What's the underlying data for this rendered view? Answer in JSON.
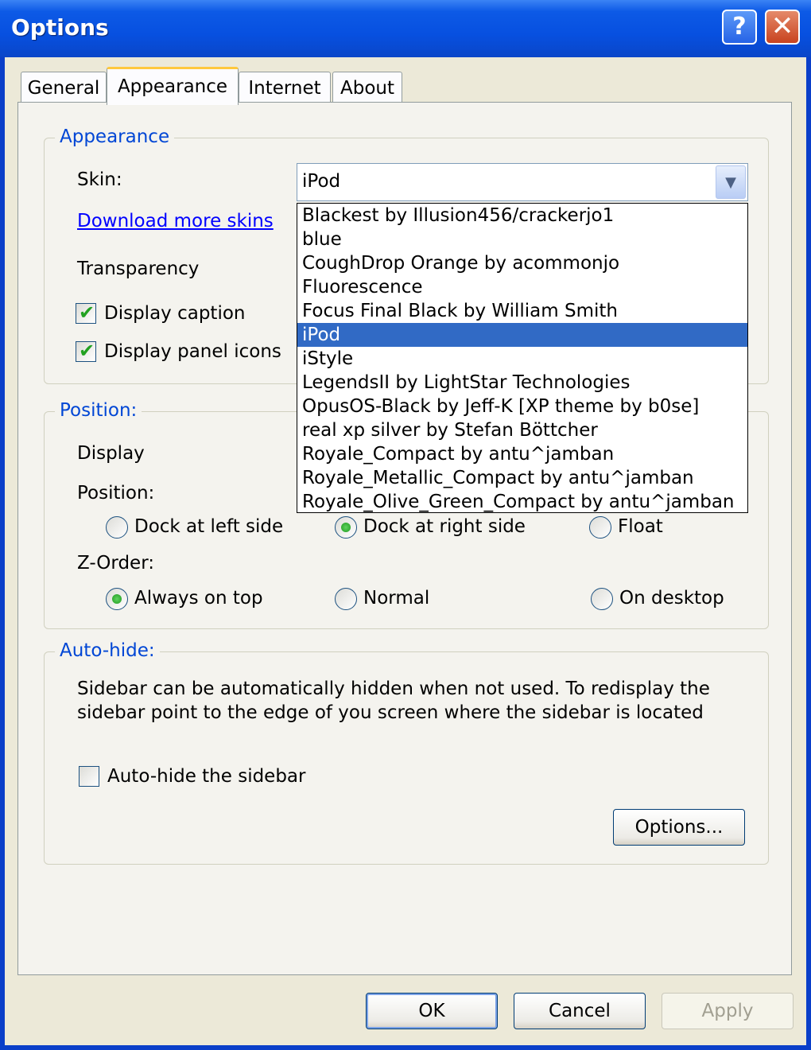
{
  "window": {
    "title": "Options",
    "help_glyph": "?",
    "close_glyph": "✕"
  },
  "tabs": [
    {
      "label": "General"
    },
    {
      "label": "Appearance"
    },
    {
      "label": "Internet"
    },
    {
      "label": "About"
    }
  ],
  "appearance": {
    "legend": "Appearance",
    "skin_label": "Skin:",
    "skin_value": "iPod",
    "download_link": "Download more skins",
    "transparency_label": "Transparency",
    "display_caption": "Display caption",
    "display_panel_icons": "Display panel icons",
    "skins": [
      "Blackest by Illusion456/crackerjo1",
      "blue",
      "CoughDrop Orange by acommonjo",
      "Fluorescence",
      "Focus Final Black by William Smith",
      "iPod",
      "iStyle",
      "LegendsII by LightStar Technologies",
      "OpusOS-Black by Jeff-K [XP theme by b0se]",
      "real xp silver by Stefan Böttcher",
      "Royale_Compact by antu^jamban",
      "Royale_Metallic_Compact by antu^jamban",
      "Royale_Olive_Green_Compact by antu^jamban"
    ]
  },
  "position": {
    "legend": "Position:",
    "display_label": "Display",
    "position_label": "Position:",
    "dock_left": "Dock at left side",
    "dock_right": "Dock at right side",
    "float": "Float",
    "zorder_label": "Z-Order:",
    "always_on_top": "Always on top",
    "normal": "Normal",
    "on_desktop": "On desktop"
  },
  "autohide": {
    "legend": "Auto-hide:",
    "desc_line1": "Sidebar can be automatically hidden when not used. To redisplay the",
    "desc_line2": "sidebar point to the edge of you screen where the sidebar is located",
    "checkbox": "Auto-hide the sidebar",
    "options_button": "Options..."
  },
  "buttons": {
    "ok": "OK",
    "cancel": "Cancel",
    "apply": "Apply"
  },
  "checkmark_glyph": "✔",
  "arrow_glyph": "▼"
}
